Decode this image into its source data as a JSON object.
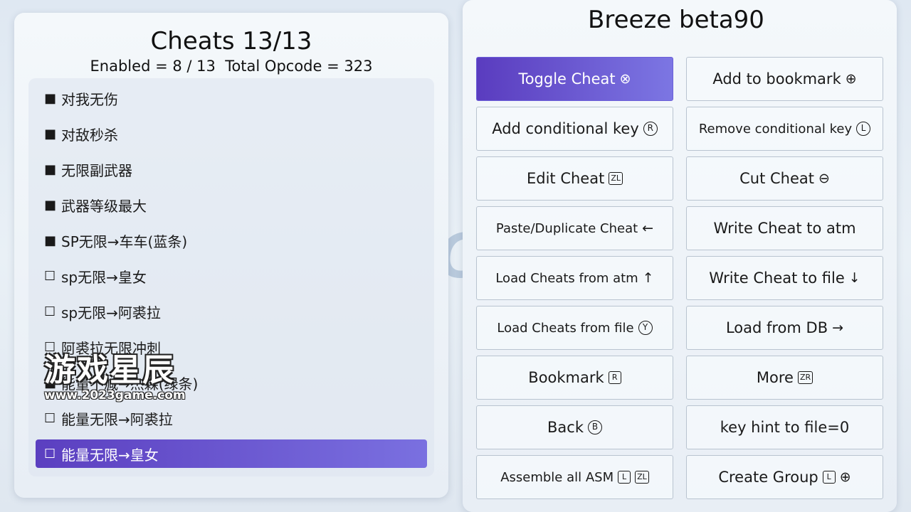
{
  "left": {
    "title": "Cheats 13/13",
    "subtitle": "Enabled = 8 / 13  Total Opcode = 323",
    "items": [
      {
        "box": "■",
        "label": "对我无伤"
      },
      {
        "box": "■",
        "label": "对敌秒杀"
      },
      {
        "box": "■",
        "label": "无限副武器"
      },
      {
        "box": "■",
        "label": "武器等级最大"
      },
      {
        "box": "■",
        "label": "SP无限→车车(蓝条)"
      },
      {
        "box": "☐",
        "label": "sp无限→皇女"
      },
      {
        "box": "☐",
        "label": "sp无限→阿裘拉"
      },
      {
        "box": "☐",
        "label": "阿裘拉无限冲刺"
      },
      {
        "box": "■",
        "label": "能量不减→杰森(绿条)"
      },
      {
        "box": "☐",
        "label": "能量无限→阿裘拉"
      },
      {
        "box": "☐",
        "label": "能量无限→皇女"
      }
    ]
  },
  "watermark": {
    "cn": "游戏星辰",
    "url": "www.2023game.com"
  },
  "background_logo": {
    "text": "INTI CREATES"
  },
  "right": {
    "title": "Breeze beta90",
    "buttons": [
      {
        "label": "Toggle Cheat",
        "icon": "⊗"
      },
      {
        "label": "Add to bookmark",
        "icon": "⊕"
      },
      {
        "label": "Add conditional key",
        "icon": "R-stick-icon"
      },
      {
        "label": "Remove conditional key",
        "icon": "L-stick-icon"
      },
      {
        "label": "Edit Cheat",
        "icon": "ZL"
      },
      {
        "label": "Cut Cheat",
        "icon": "⊖"
      },
      {
        "label": "Paste/Duplicate Cheat",
        "icon": "←"
      },
      {
        "label": "Write Cheat to atm",
        "icon": ""
      },
      {
        "label": "Load Cheats from atm",
        "icon": "↑"
      },
      {
        "label": "Write Cheat to file",
        "icon": "↓"
      },
      {
        "label": "Load Cheats from file",
        "icon": "Y"
      },
      {
        "label": "Load from DB",
        "icon": "→"
      },
      {
        "label": "Bookmark",
        "icon": "R"
      },
      {
        "label": "More",
        "icon": "ZR"
      },
      {
        "label": "Back",
        "icon": "B"
      },
      {
        "label": "key hint to file=0",
        "icon": ""
      },
      {
        "label": "Assemble all ASM",
        "icon": "L ZL"
      },
      {
        "label": "Create Group",
        "icon": "L ⊕"
      }
    ]
  }
}
